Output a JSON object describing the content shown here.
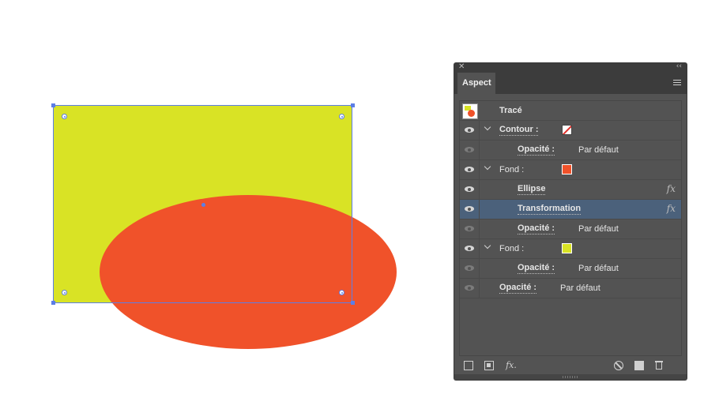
{
  "app": {
    "panel_title": "Aspect"
  },
  "colors": {
    "fill_yellow": "#d9e325",
    "fill_red": "#f0522a",
    "selection": "#5c7ee6",
    "panel_bg": "#535353",
    "row_selected": "#4b617b"
  },
  "panel": {
    "tab_label": "Aspect",
    "rows": [
      {
        "label": "Tracé"
      },
      {
        "label": "Contour :",
        "swatch": "none"
      },
      {
        "label": "Opacité :",
        "value": "Par défaut"
      },
      {
        "label": "Fond :",
        "swatch": "#f0522a"
      },
      {
        "label": "Ellipse",
        "fx": "fx"
      },
      {
        "label": "Transformation",
        "fx": "fx",
        "selected": true
      },
      {
        "label": "Opacité :",
        "value": "Par défaut"
      },
      {
        "label": "Fond :",
        "swatch": "#d9e325"
      },
      {
        "label": "Opacité :",
        "value": "Par défaut"
      },
      {
        "label": "Opacité :",
        "value": "Par défaut"
      }
    ],
    "bottom_fx": "fx."
  }
}
